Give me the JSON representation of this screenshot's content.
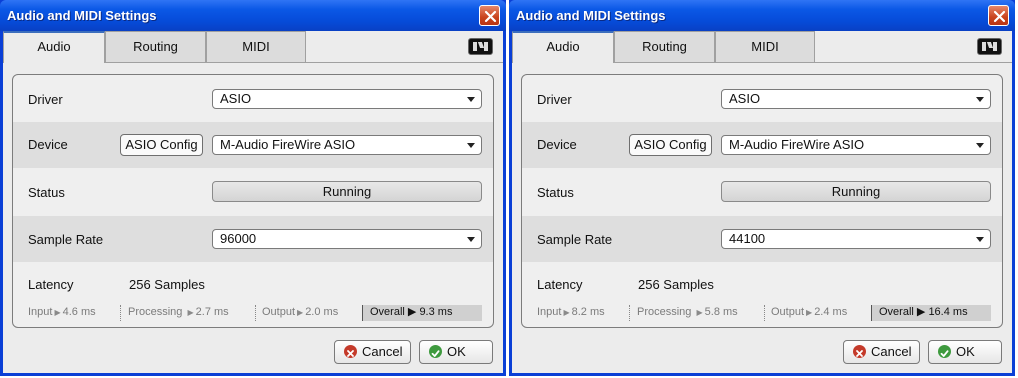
{
  "windows": [
    {
      "title": "Audio and MIDI Settings",
      "tabs": [
        "Audio",
        "Routing",
        "MIDI"
      ],
      "active_tab": "Audio",
      "driver": {
        "label": "Driver",
        "value": "ASIO"
      },
      "device": {
        "label": "Device",
        "config_button": "ASIO Config",
        "value": "M-Audio FireWire ASIO"
      },
      "status": {
        "label": "Status",
        "value": "Running"
      },
      "sample_rate": {
        "label": "Sample Rate",
        "value": "96000"
      },
      "latency": {
        "label": "Latency",
        "value": "256 Samples",
        "input_label": "Input",
        "input_value": "4.6 ms",
        "processing_label": "Processing",
        "processing_value": "2.7 ms",
        "output_label": "Output",
        "output_value": "2.0 ms",
        "overall_label": "Overall",
        "overall_value": "9.3 ms"
      },
      "buttons": {
        "cancel": "Cancel",
        "ok": "OK"
      }
    },
    {
      "title": "Audio and MIDI Settings",
      "tabs": [
        "Audio",
        "Routing",
        "MIDI"
      ],
      "active_tab": "Audio",
      "driver": {
        "label": "Driver",
        "value": "ASIO"
      },
      "device": {
        "label": "Device",
        "config_button": "ASIO Config",
        "value": "M-Audio FireWire ASIO"
      },
      "status": {
        "label": "Status",
        "value": "Running"
      },
      "sample_rate": {
        "label": "Sample Rate",
        "value": "44100"
      },
      "latency": {
        "label": "Latency",
        "value": "256 Samples",
        "input_label": "Input",
        "input_value": "8.2 ms",
        "processing_label": "Processing",
        "processing_value": "5.8 ms",
        "output_label": "Output",
        "output_value": "2.4 ms",
        "overall_label": "Overall",
        "overall_value": "16.4 ms"
      },
      "buttons": {
        "cancel": "Cancel",
        "ok": "OK"
      }
    }
  ],
  "icons": {
    "close": "close-icon",
    "logo": "native-instruments-logo-icon",
    "dropdown": "chevron-down-icon",
    "cancel": "cancel-circle-icon",
    "ok": "check-circle-icon",
    "arrow": "triangle-right-icon"
  },
  "colors": {
    "titlebar": "#0b58e6",
    "close_button": "#c9431c",
    "cancel_icon": "#c43a2a",
    "ok_icon": "#3e9a3e"
  }
}
